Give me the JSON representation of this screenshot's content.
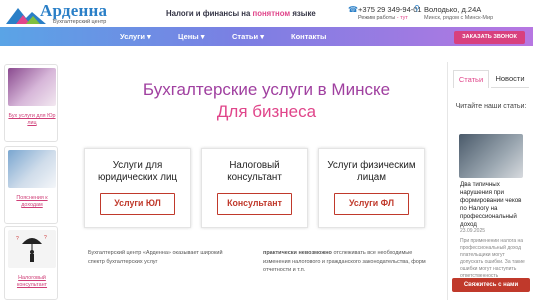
{
  "header": {
    "brand": "Арденна",
    "brand_sub": "Бухгалтерский центр",
    "tagline_pre": "Налоги и финансы на",
    "tagline_accent": "понятном",
    "tagline_post": "языке",
    "phone": "+375 29 349-94-01",
    "hours_label": "Режим работы",
    "hours_value": "- тут",
    "address": "Володько, д.24А",
    "address_sub": "Минск, рядом с Минск-Мир"
  },
  "nav": {
    "items": [
      {
        "label": "Услуги"
      },
      {
        "label": "Цены"
      },
      {
        "label": "Статьи"
      },
      {
        "label": "Контакты"
      }
    ],
    "cta": "ЗАКАЗАТЬ ЗВОНОК"
  },
  "sidebar_left": {
    "cards": [
      {
        "label": "Бух услуги для Юр лиц"
      },
      {
        "label": "Пояснения к доходам"
      },
      {
        "label": "Налоговый консультант"
      }
    ]
  },
  "main": {
    "title": "Бухгалтерские услуги в Минске",
    "subtitle": "Для бизнеса",
    "services": [
      {
        "heading": "Услуги для юридических лиц",
        "button": "Услуги ЮЛ"
      },
      {
        "heading": "Налоговый консультант",
        "button": "Консультант"
      },
      {
        "heading": "Услуги физическим лицам",
        "button": "Услуги ФЛ"
      }
    ],
    "intro_left": "Бухгалтерский центр «Арденна» оказывает широкий спектр бухгалтерских услуг",
    "intro_right_bold": "практически невозможно",
    "intro_right": "отслеживать все необходимые изменения налогового и гражданского законодательства, форм отчетности и т.п."
  },
  "sidebar_right": {
    "tabs": [
      {
        "label": "Статьи"
      },
      {
        "label": "Новости"
      }
    ],
    "heading": "Читайте наши статьи:",
    "article_title": "Два типичных нарушения при формировании чеков по Налогу на профессиональный доход",
    "article_date": "23.09.2025",
    "article_excerpt": "При применении налога на профессиональный доход плательщики могут допускать ошибки. За такие ошибки могут наступить ответственность",
    "contact_button": "Свяжитесь с нами"
  },
  "colors": {
    "brand_blue": "#2a7fc7",
    "accent_pink": "#e0458a",
    "title_purple": "#a040a0",
    "button_red": "#c0392b"
  }
}
